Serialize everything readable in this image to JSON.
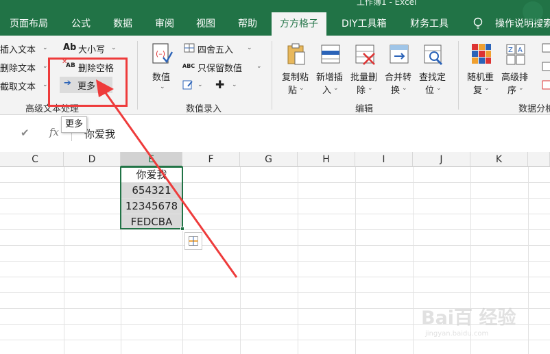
{
  "app": {
    "title_fragment": "工作簿1 - Excel"
  },
  "tabs": [
    {
      "label": "页面布局"
    },
    {
      "label": "公式"
    },
    {
      "label": "数据"
    },
    {
      "label": "审阅"
    },
    {
      "label": "视图"
    },
    {
      "label": "帮助"
    },
    {
      "label": "方方格子",
      "active": true
    },
    {
      "label": "DIY工具箱"
    },
    {
      "label": "财务工具"
    },
    {
      "label": "操作说明搜索"
    }
  ],
  "ribbon": {
    "text_group": {
      "insert_text": "插入文本",
      "delete_text": "删除文本",
      "extract_text": "截取文本",
      "case": "大小写",
      "case_icon": "Ab",
      "delete_spaces": "删除空格",
      "delete_spaces_icon": "AB",
      "more": "更多",
      "label": "高级文本处理"
    },
    "number_group": {
      "value": "数值",
      "round": "四舍五入",
      "keep_values": "只保留数值",
      "keep_values_icon": "ABC",
      "label": "数值录入"
    },
    "edit_group": {
      "copy_paste_1": "复制粘",
      "copy_paste_2": "贴",
      "new_insert_1": "新增插",
      "new_insert_2": "入",
      "batch_delete_1": "批量删",
      "batch_delete_2": "除",
      "merge_convert_1": "合并转",
      "merge_convert_2": "换",
      "find_locate_1": "查找定",
      "find_locate_2": "位",
      "label": "编辑"
    },
    "data_group": {
      "random_1": "随机重",
      "random_2": "复",
      "sort_1": "高级排",
      "sort_2": "序",
      "label": "数据分析"
    }
  },
  "tooltip": "更多",
  "formula_bar": {
    "value": "你爱我"
  },
  "columns": [
    "C",
    "D",
    "E",
    "F",
    "G",
    "H",
    "I",
    "J",
    "K"
  ],
  "cells": [
    "你爱我",
    "654321",
    "12345678",
    "FEDCBA"
  ],
  "watermark": {
    "text": "Bai百 经验",
    "url": "jingyan.baidu.com"
  },
  "colors": {
    "excel_green": "#217346",
    "annotation_red": "#ee3b3b"
  }
}
